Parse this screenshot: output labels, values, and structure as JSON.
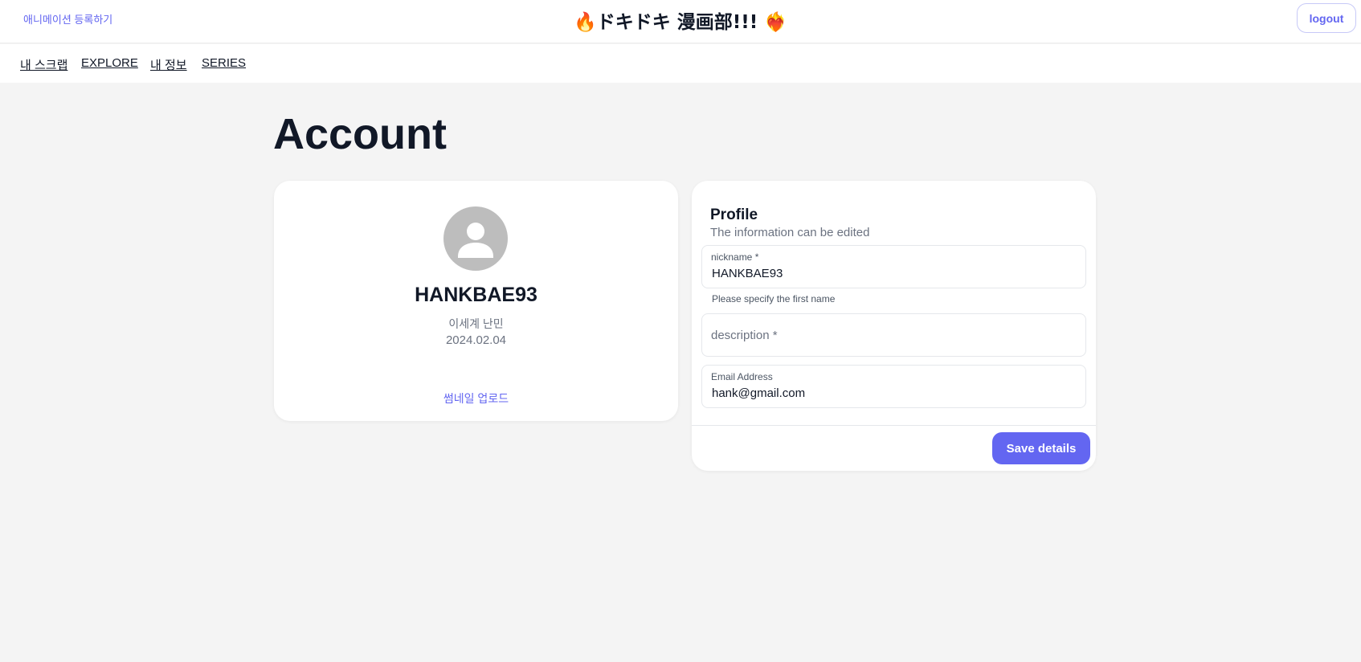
{
  "header": {
    "register_link": "애니메이션 등록하기",
    "title": "🔥ドキドキ 漫画部!!! ❤️‍🔥",
    "logout": "logout"
  },
  "nav": {
    "items": [
      {
        "label": "내 스크랩"
      },
      {
        "label": "EXPLORE"
      },
      {
        "label": "내 정보"
      },
      {
        "label": "SERIES"
      }
    ]
  },
  "page": {
    "title": "Account"
  },
  "profile_card": {
    "avatar_icon": "user-icon",
    "name": "HANKBAE93",
    "subtitle": "이세계 난민",
    "date": "2024.02.04",
    "upload_label": "썸네일 업로드"
  },
  "profile_form": {
    "heading": "Profile",
    "subheading": "The information can be edited",
    "nickname": {
      "label": "nickname *",
      "value": "HANKBAE93",
      "helper": "Please specify the first name"
    },
    "description": {
      "placeholder": "description *"
    },
    "email": {
      "label": "Email Address",
      "value": "hank@gmail.com"
    },
    "save_label": "Save details"
  },
  "colors": {
    "accent": "#6366f1",
    "background": "#f4f4f4",
    "avatar": "#bdbdbd"
  }
}
